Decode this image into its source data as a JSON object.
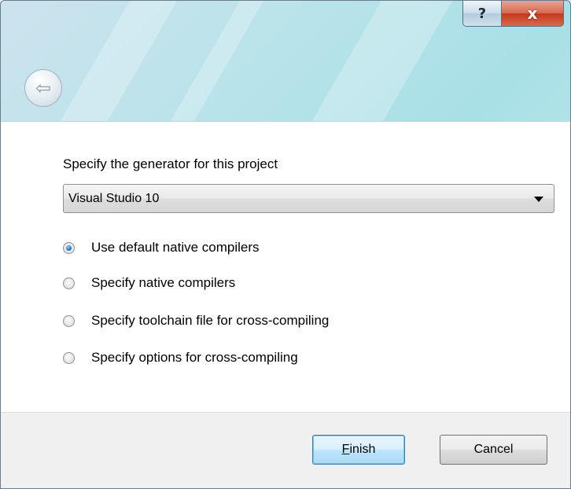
{
  "titlebar": {
    "help_glyph": "?",
    "close_glyph": "x"
  },
  "back_button": {
    "icon": "back-arrow-icon",
    "glyph": "⇦"
  },
  "main": {
    "prompt": "Specify the generator for this project",
    "generator": {
      "selected": "Visual Studio 10"
    },
    "options": [
      {
        "label": "Use default native compilers",
        "checked": true
      },
      {
        "label": "Specify native compilers",
        "checked": false
      },
      {
        "label": "Specify toolchain file for cross-compiling",
        "checked": false
      },
      {
        "label": "Specify options for cross-compiling",
        "checked": false
      }
    ]
  },
  "footer": {
    "finish_label": "Finish",
    "cancel_label": "Cancel"
  },
  "colors": {
    "accent": "#1a74c9",
    "close_button": "#c3381c",
    "caption": "#a8e0e6"
  }
}
